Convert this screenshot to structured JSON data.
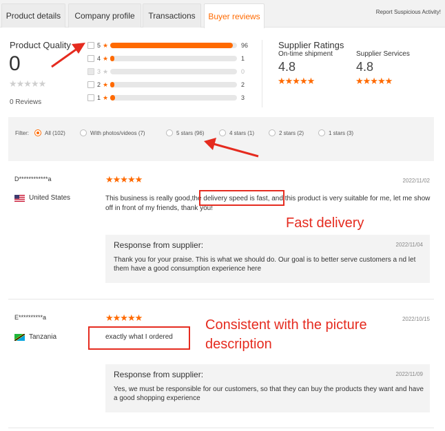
{
  "tabs": [
    "Product details",
    "Company profile",
    "Transactions",
    "Buyer reviews"
  ],
  "report_link": "Report Suspicious Activity!",
  "product_quality": {
    "title": "Product Quality",
    "score": "0",
    "stars": "★★★★★",
    "reviews": "0 Reviews"
  },
  "rating_rows": [
    {
      "stars": "5",
      "count": "96",
      "fraction": 0.97,
      "disabled": false
    },
    {
      "stars": "4",
      "count": "1",
      "fraction": 0.02,
      "disabled": false
    },
    {
      "stars": "3",
      "count": "0",
      "fraction": 0.0,
      "disabled": true
    },
    {
      "stars": "2",
      "count": "2",
      "fraction": 0.03,
      "disabled": false
    },
    {
      "stars": "1",
      "count": "3",
      "fraction": 0.04,
      "disabled": false
    }
  ],
  "supplier_ratings": {
    "title": "Supplier Ratings",
    "on_time_label": "On-time shipment",
    "on_time_value": "4.8",
    "services_label": "Supplier Services",
    "services_value": "4.8",
    "stars": "★★★★★"
  },
  "filter": {
    "label": "Filter:",
    "options": [
      "All (102)",
      "With photos/videos (7)",
      "5 stars (96)",
      "4 stars (1)",
      "2 stars (2)",
      "1 stars (3)"
    ],
    "selected": "All (102)"
  },
  "reviews": [
    {
      "user": "D************a",
      "country": "United States",
      "stars": "★★★★★",
      "date": "2022/11/02",
      "text_before": "This business is really good,",
      "text_highlight": "the delivery speed is fast",
      "text_after": ", and this product is very suitable for me, let me show off in front of my friends, thank you!",
      "response_title": "Response from supplier:",
      "response_date": "2022/11/04",
      "response_text": "Thank you for your praise. This is what we should do. Our goal is to better serve customers a nd let them have a good consumption experience here"
    },
    {
      "user": "E**********a",
      "country": "Tanzania",
      "stars": "★★★★★",
      "date": "2022/10/15",
      "text": "exactly what I ordered",
      "response_title": "Response from supplier:",
      "response_date": "2022/11/09",
      "response_text": "Yes, we must be responsible for our customers, so that they can buy the products they want and have a good shopping experience"
    }
  ],
  "annotations": {
    "fast_delivery": "Fast delivery",
    "consistent_line1": "Consistent with the picture",
    "consistent_line2": "description"
  },
  "colors": {
    "accent": "#ff6a00",
    "annotation": "#e52b1f"
  }
}
